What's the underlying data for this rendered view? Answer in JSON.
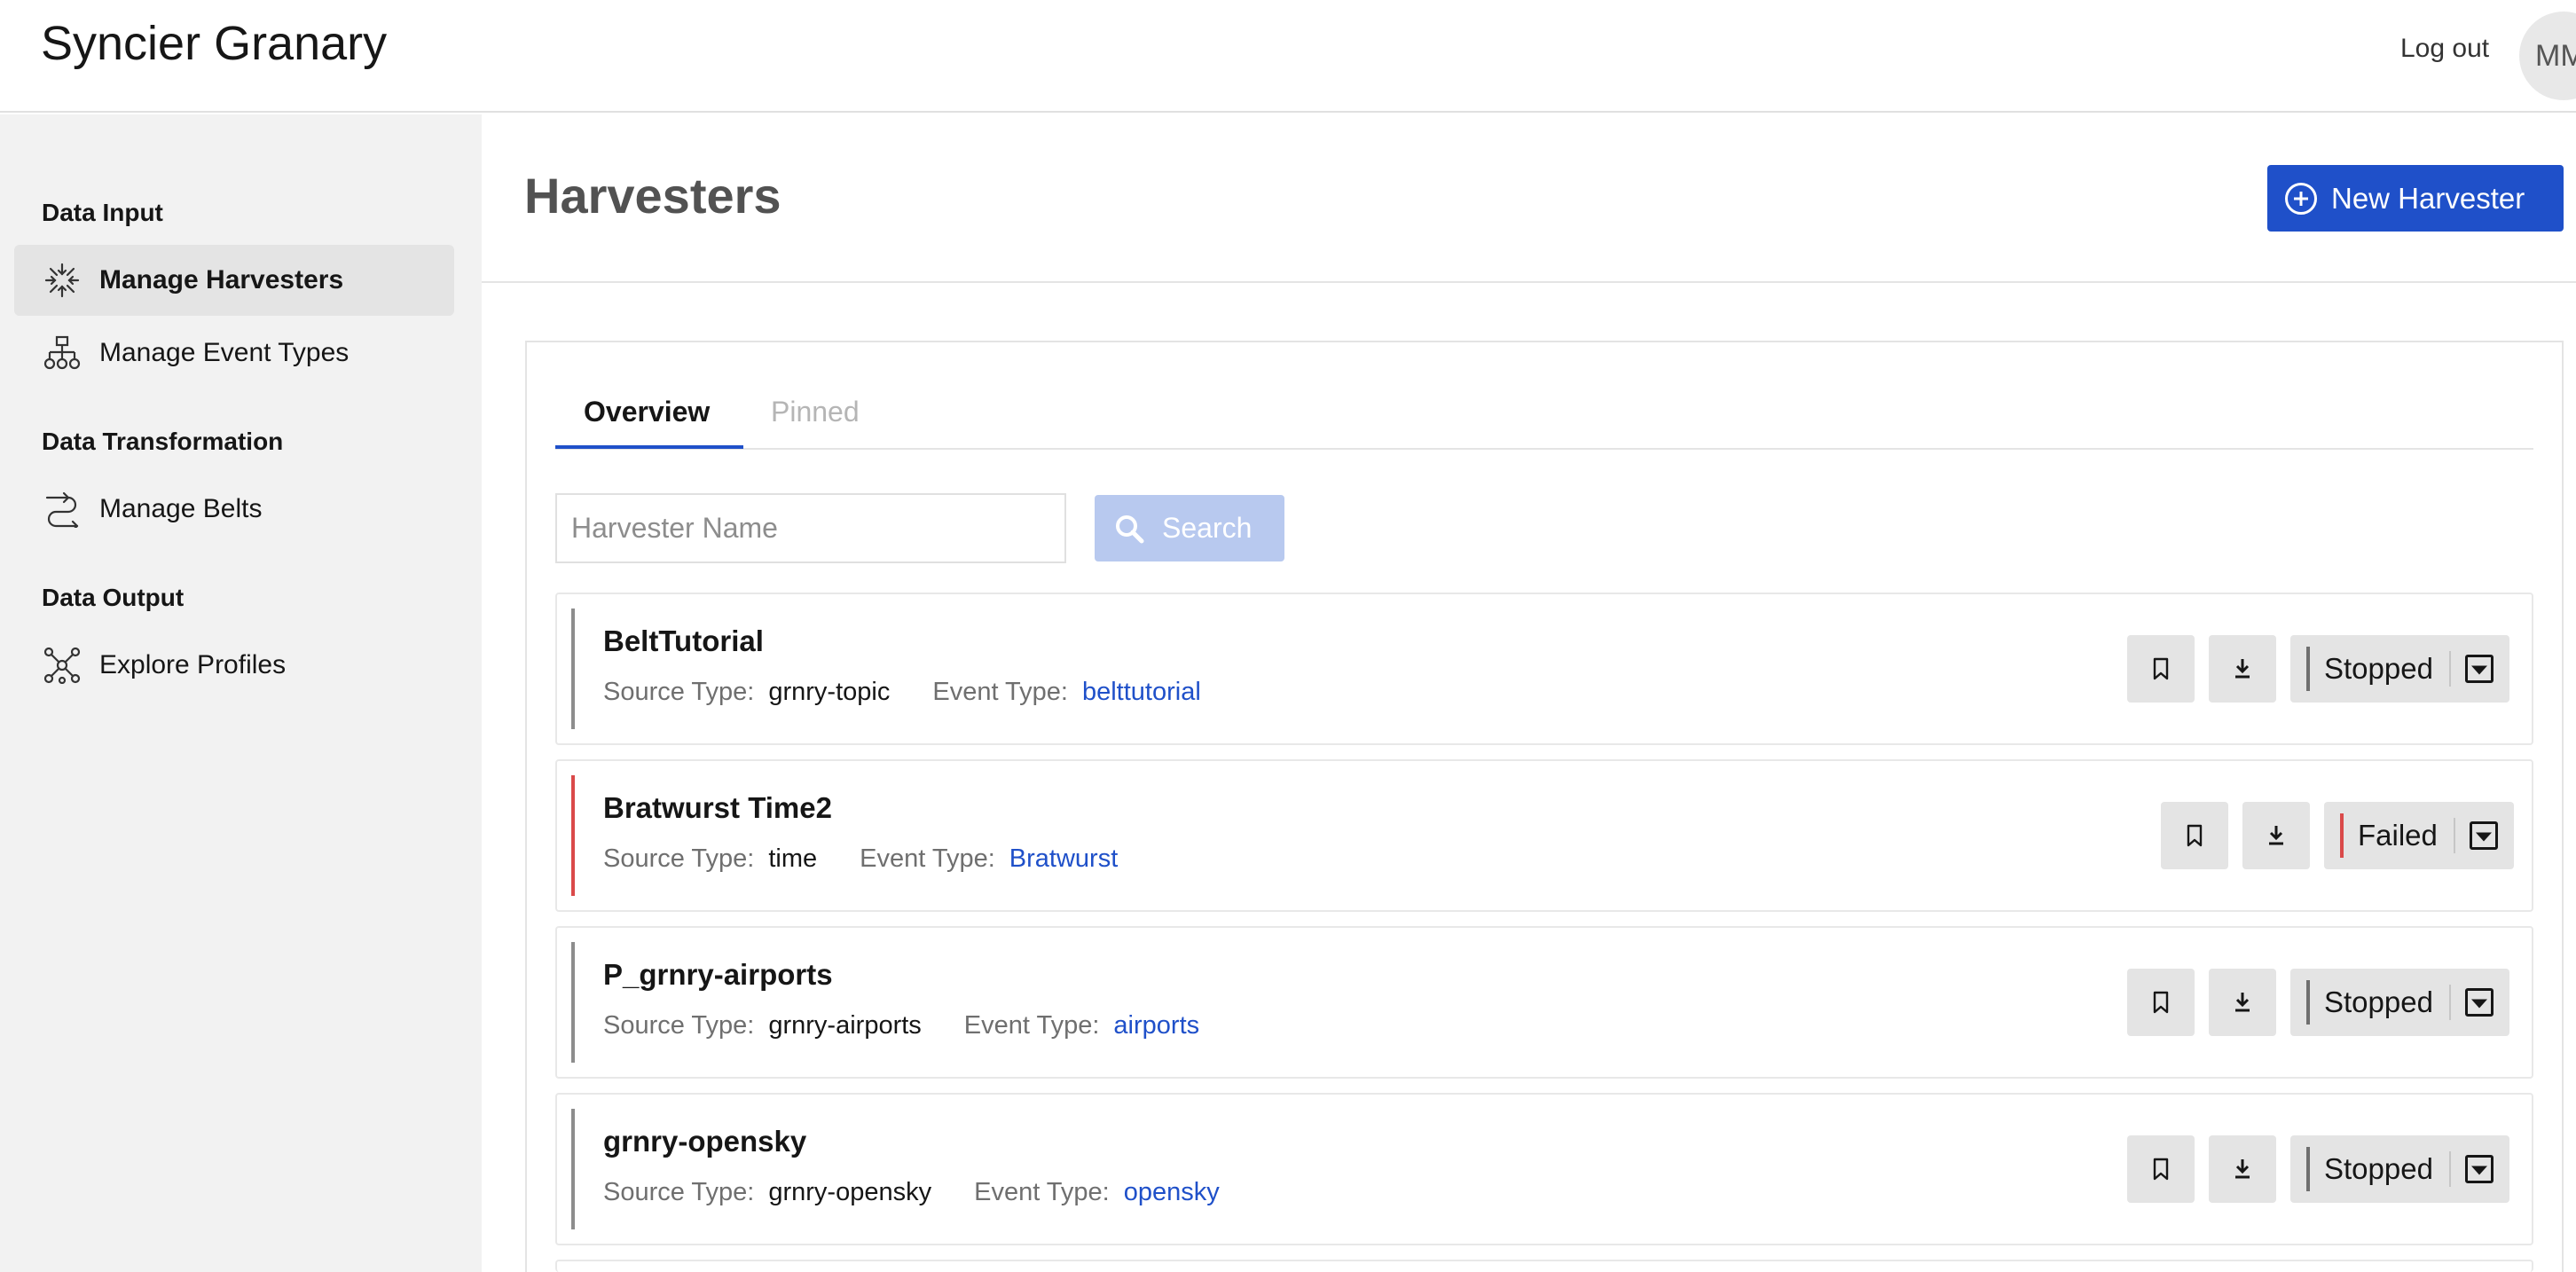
{
  "header": {
    "app_title": "Syncier Granary",
    "logout_label": "Log out",
    "avatar_initials": "MM"
  },
  "sidebar": {
    "sections": [
      {
        "heading": "Data Input",
        "items": [
          {
            "label": "Manage Harvesters",
            "icon": "harvester-icon",
            "active": true
          },
          {
            "label": "Manage Event Types",
            "icon": "hierarchy-icon",
            "active": false
          }
        ]
      },
      {
        "heading": "Data Transformation",
        "items": [
          {
            "label": "Manage Belts",
            "icon": "belt-route-icon",
            "active": false
          }
        ]
      },
      {
        "heading": "Data Output",
        "items": [
          {
            "label": "Explore Profiles",
            "icon": "network-icon",
            "active": false
          }
        ]
      }
    ]
  },
  "main": {
    "page_title": "Harvesters",
    "new_button_label": "New Harvester",
    "tabs": [
      {
        "label": "Overview",
        "active": true
      },
      {
        "label": "Pinned",
        "active": false
      }
    ],
    "search": {
      "placeholder": "Harvester Name",
      "value": "",
      "button_label": "Search"
    },
    "source_type_label": "Source Type:",
    "event_type_label": "Event Type:",
    "harvesters": [
      {
        "name": "BeltTutorial",
        "source_type": "grnry-topic",
        "event_type": "belttutorial",
        "status": "Stopped"
      },
      {
        "name": "Bratwurst Time2",
        "source_type": "time",
        "event_type": "Bratwurst",
        "status": "Failed"
      },
      {
        "name": "P_grnry-airports",
        "source_type": "grnry-airports",
        "event_type": "airports",
        "status": "Stopped"
      },
      {
        "name": "grnry-opensky",
        "source_type": "grnry-opensky",
        "event_type": "opensky",
        "status": "Stopped"
      }
    ]
  },
  "colors": {
    "accent": "#1f50c9",
    "failed": "#da4a4a",
    "stopped": "#6f6f6f"
  }
}
